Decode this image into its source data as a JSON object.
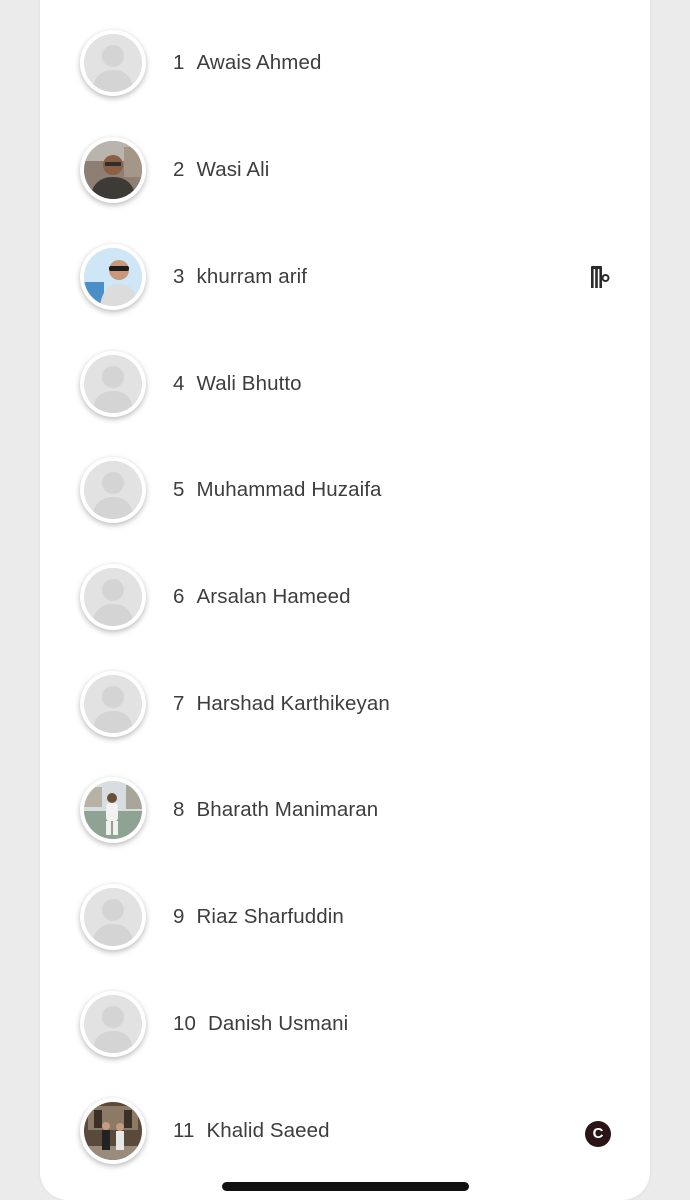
{
  "players": [
    {
      "number": "1",
      "name": "Awais Ahmed",
      "photo": "placeholder",
      "badge": null
    },
    {
      "number": "2",
      "name": "Wasi Ali",
      "photo": "photo-indoor-man",
      "badge": null
    },
    {
      "number": "3",
      "name": "khurram arif",
      "photo": "photo-sunglasses-man",
      "badge": "wicket-keeper-icon"
    },
    {
      "number": "4",
      "name": "Wali Bhutto",
      "photo": "placeholder",
      "badge": null
    },
    {
      "number": "5",
      "name": "Muhammad Huzaifa",
      "photo": "placeholder",
      "badge": null
    },
    {
      "number": "6",
      "name": "Arsalan Hameed",
      "photo": "placeholder",
      "badge": null
    },
    {
      "number": "7",
      "name": "Harshad Karthikeyan",
      "photo": "placeholder",
      "badge": null
    },
    {
      "number": "8",
      "name": "Bharath Manimaran",
      "photo": "photo-cricketer-field",
      "badge": null
    },
    {
      "number": "9",
      "name": "Riaz Sharfuddin",
      "photo": "placeholder",
      "badge": null
    },
    {
      "number": "10",
      "name": "Danish Usmani",
      "photo": "placeholder",
      "badge": null
    },
    {
      "number": "11",
      "name": "Khalid Saeed",
      "photo": "photo-group-hall",
      "badge": "captain-icon"
    }
  ],
  "captain_badge_letter": "C",
  "colors": {
    "background": "#ebebeb",
    "card": "#ffffff",
    "text": "#3d3d3d",
    "placeholder": "#e2e2e2",
    "captain_badge": "#2a1416"
  }
}
